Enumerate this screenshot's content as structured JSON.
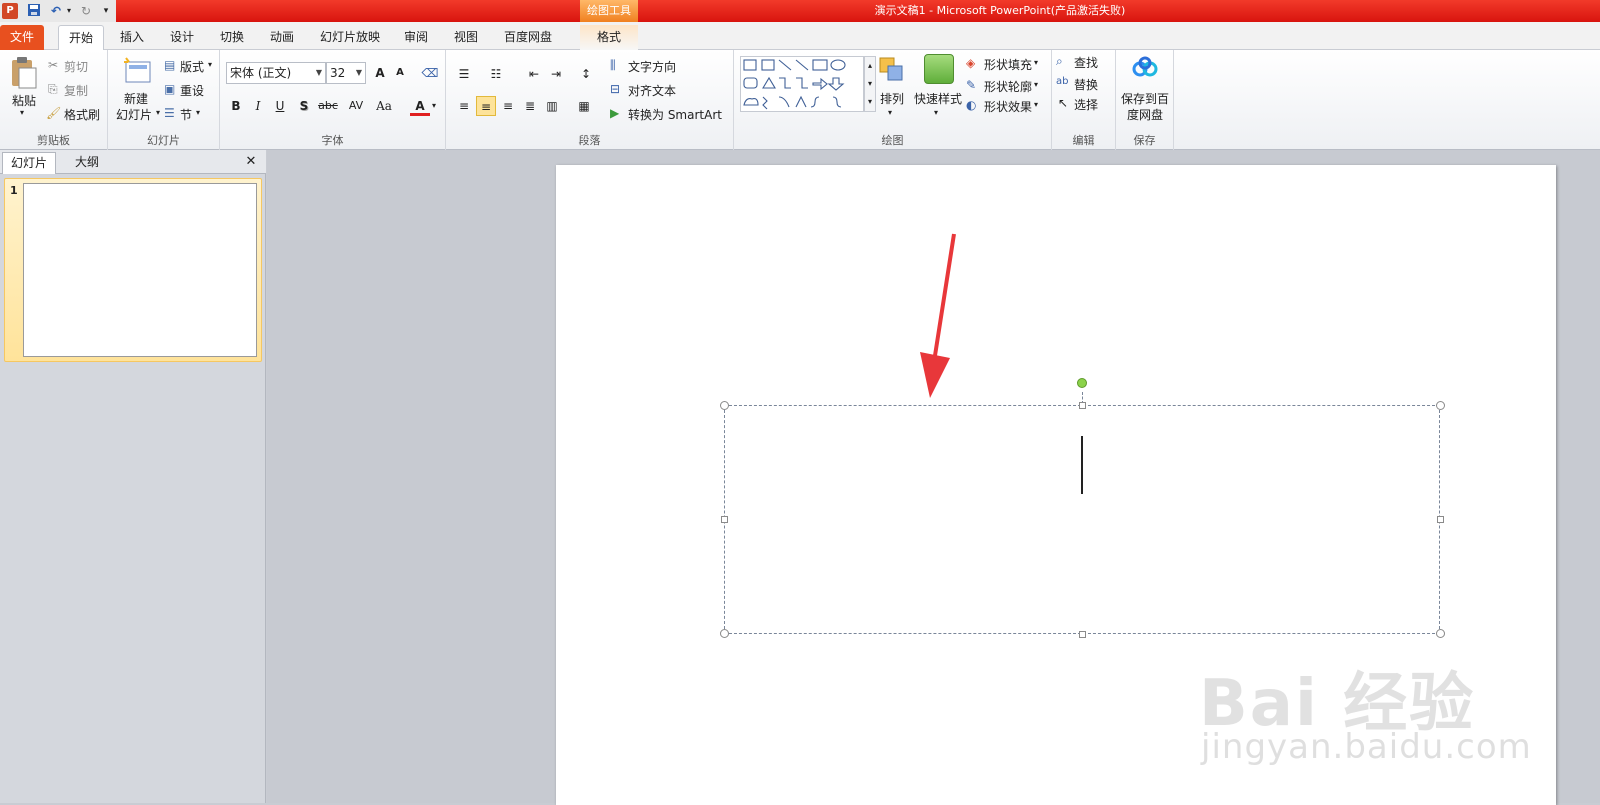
{
  "titlebar": {
    "app_icon": "P",
    "contextual_tab_group": "绘图工具",
    "window_title": "演示文稿1 - Microsoft PowerPoint(产品激活失败)"
  },
  "tabs": [
    "文件",
    "开始",
    "插入",
    "设计",
    "切换",
    "动画",
    "幻灯片放映",
    "审阅",
    "视图",
    "百度网盘",
    "格式"
  ],
  "ribbon": {
    "clipboard": {
      "paste": "粘贴",
      "cut": "剪切",
      "copy": "复制",
      "format_painter": "格式刷",
      "label": "剪贴板"
    },
    "slides": {
      "new_slide_1": "新建",
      "new_slide_2": "幻灯片",
      "layout": "版式",
      "reset": "重设",
      "section": "节",
      "label": "幻灯片"
    },
    "font": {
      "font_name": "宋体 (正文)",
      "font_size": "32",
      "grow": "A",
      "shrink": "A",
      "bold": "B",
      "italic": "I",
      "underline": "U",
      "shadow": "S",
      "strike": "abc",
      "spacing": "AV",
      "case": "Aa",
      "color": "A",
      "label": "字体"
    },
    "paragraph": {
      "text_direction": "文字方向",
      "align_text": "对齐文本",
      "smartart": "转换为 SmartArt",
      "label": "段落"
    },
    "drawing": {
      "arrange": "排列",
      "quick_styles": "快速样式",
      "shape_fill": "形状填充",
      "shape_outline": "形状轮廓",
      "shape_effects": "形状效果",
      "label": "绘图"
    },
    "editing": {
      "find": "查找",
      "replace": "替换",
      "select": "选择",
      "label": "编辑"
    },
    "save": {
      "line1": "保存到百",
      "line2": "度网盘",
      "label": "保存"
    }
  },
  "leftpane": {
    "tab_slides": "幻灯片",
    "tab_outline": "大纲",
    "close": "✕",
    "slide_number": "1"
  },
  "watermark": {
    "line1": "Bai 经验",
    "line2": "jingyan.baidu.com"
  },
  "colors": {
    "title_red": "#e0201a",
    "file_tab": "#e8501f",
    "arrow_red": "#e8373a",
    "accent_orange": "#f08020"
  }
}
